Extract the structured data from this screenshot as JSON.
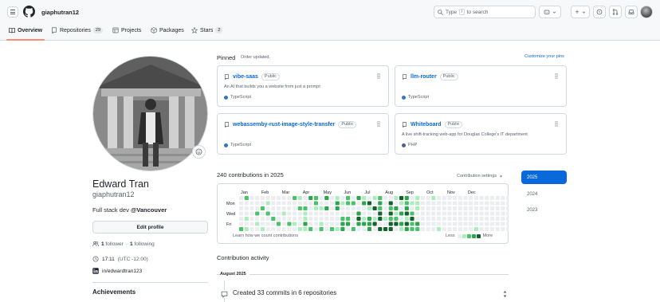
{
  "header": {
    "username": "giaphutran12",
    "search": {
      "prefix": "Type",
      "key": "/",
      "suffix": "to search"
    },
    "plus_label": "+",
    "icons": [
      "menu-icon",
      "github-logo-icon",
      "search-icon",
      "copilot-icon",
      "chevron-down-icon",
      "plus-icon",
      "issues-icon",
      "pull-requests-icon",
      "inbox-icon",
      "avatar"
    ]
  },
  "tabs": [
    {
      "label": "Overview",
      "icon": "book-icon",
      "active": true
    },
    {
      "label": "Repositories",
      "icon": "repo-icon",
      "count": "29"
    },
    {
      "label": "Projects",
      "icon": "table-icon"
    },
    {
      "label": "Packages",
      "icon": "package-icon"
    },
    {
      "label": "Stars",
      "icon": "star-icon",
      "count": "2"
    }
  ],
  "profile": {
    "name": "Edward Tran",
    "login": "giaphutran12",
    "bio_text": "Full stack dev ",
    "bio_handle": "@Vancouver",
    "edit_label": "Edit profile",
    "followers_count": "1",
    "followers_label": "follower",
    "following_count": "1",
    "following_label": "following",
    "follow_dot": "·",
    "time": "17:11",
    "tz": "(UTC -12:00)",
    "linkedin": "in/edwardtran123",
    "achievements": "Achievements"
  },
  "pinned": {
    "title": "Pinned",
    "subtitle": "Order updated.",
    "customize": "Customize your pins",
    "repos": [
      {
        "name": "vibe-saas",
        "visibility": "Public",
        "description": "An AI that builds you a website from just a prompt",
        "language": "TypeScript",
        "lang_color": "#3178c6"
      },
      {
        "name": "llm-router",
        "visibility": "Public",
        "description": "",
        "language": "TypeScript",
        "lang_color": "#3178c6"
      },
      {
        "name": "webassemby-rust-image-style-transfer",
        "visibility": "Public",
        "description": "",
        "language": "TypeScript",
        "lang_color": "#3178c6"
      },
      {
        "name": "Whiteboard",
        "visibility": "Public",
        "description": "A live shift-tracking web-app for Douglas College's IT department",
        "language": "PHP",
        "lang_color": "#4F5D95"
      }
    ]
  },
  "contributions": {
    "title": "240 contributions in 2025",
    "settings": "Contribution settings",
    "months": [
      "Jan",
      "Feb",
      "Mar",
      "Apr",
      "May",
      "Jun",
      "Jul",
      "Aug",
      "Sep",
      "Oct",
      "Nov",
      "Dec"
    ],
    "days": [
      "Mon",
      "Wed",
      "Fri"
    ],
    "learn": "Learn how we count contributions",
    "less": "Less",
    "more": "More",
    "colors": [
      "#ebedf0",
      "#aceebb",
      "#4ac26b",
      "#2da44e",
      "#116329"
    ],
    "years": [
      "2025",
      "2024",
      "2023"
    ]
  },
  "activity": {
    "title": "Contribution activity",
    "month": "August 2025",
    "item": "Created 33 commits in 6 repositories"
  }
}
